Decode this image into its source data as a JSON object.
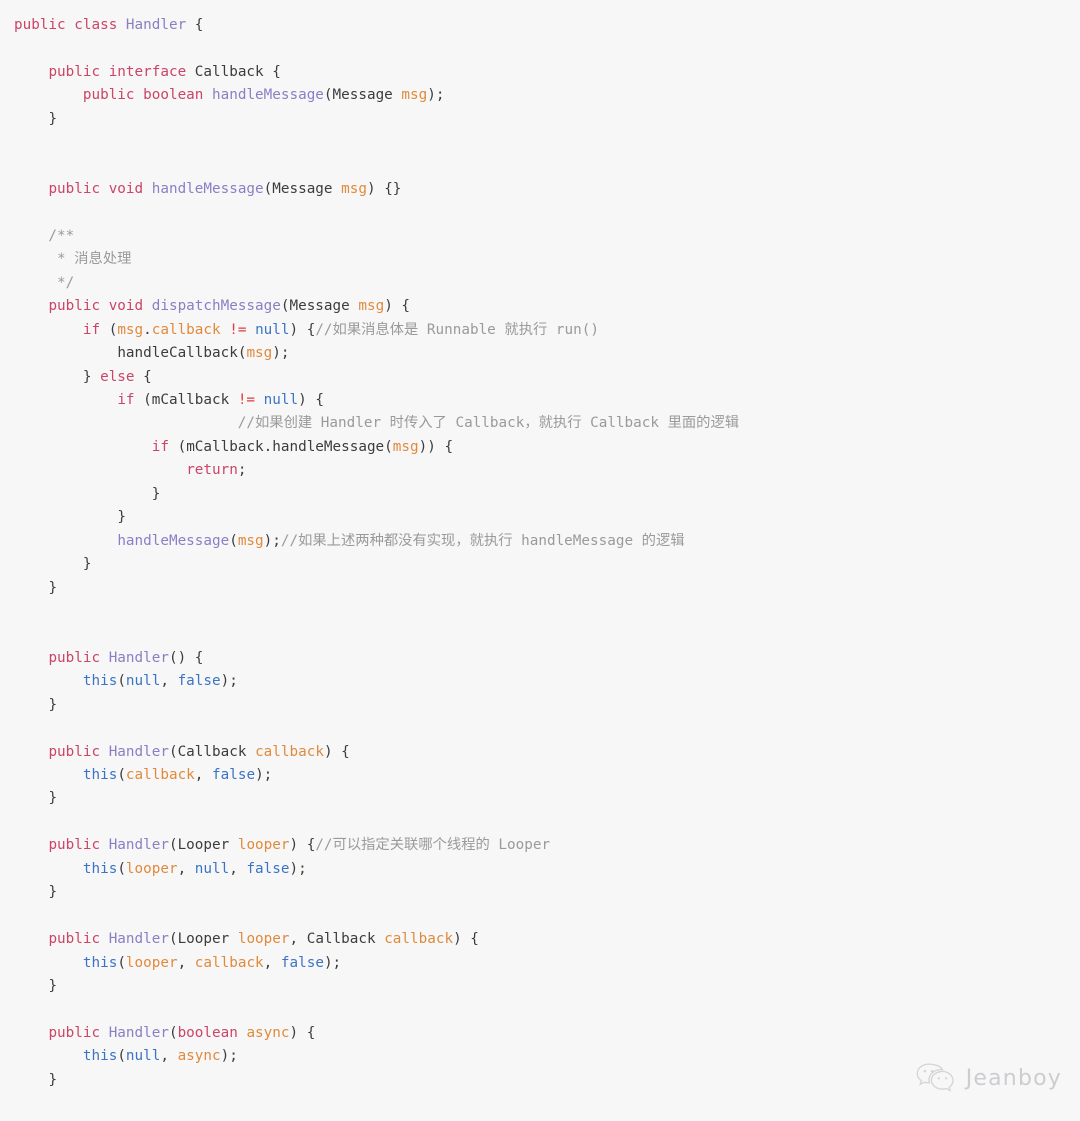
{
  "editor": {
    "language": "java",
    "background_color": "#f7f7f8",
    "default_text_color": "#3c3c3c",
    "colors": {
      "keyword": "#cc4466",
      "type_name": "#8a7fc4",
      "literal": "#3b74c4",
      "parameter": "#e08a3c",
      "operator": "#e03a3a",
      "comment": "#9a9a9a",
      "plain": "#3c3c3c"
    }
  },
  "code": {
    "lines": [
      "public class Handler {",
      "",
      "    public interface Callback {",
      "        public boolean handleMessage(Message msg);",
      "    }",
      "",
      "",
      "    public void handleMessage(Message msg) {}",
      "",
      "    /**",
      "     * 消息处理",
      "     */",
      "    public void dispatchMessage(Message msg) {",
      "        if (msg.callback != null) {//如果消息体是 Runnable 就执行 run()",
      "            handleCallback(msg);",
      "        } else {",
      "            if (mCallback != null) {",
      "                          //如果创建 Handler 时传入了 Callback，就执行 Callback 里面的逻辑",
      "                if (mCallback.handleMessage(msg)) {",
      "                    return;",
      "                }",
      "            }",
      "            handleMessage(msg);//如果上述两种都没有实现，就执行 handleMessage 的逻辑",
      "        }",
      "    }",
      "",
      "",
      "    public Handler() {",
      "        this(null, false);",
      "    }",
      "",
      "    public Handler(Callback callback) {",
      "        this(callback, false);",
      "    }",
      "",
      "    public Handler(Looper looper) {//可以指定关联哪个线程的 Looper",
      "        this(looper, null, false);",
      "    }",
      "",
      "    public Handler(Looper looper, Callback callback) {",
      "        this(looper, callback, false);",
      "    }",
      "",
      "    public Handler(boolean async) {",
      "        this(null, async);",
      "    }"
    ],
    "comments": [
      "/**",
      "* 消息处理",
      "*/",
      "//如果消息体是 Runnable 就执行 run()",
      "//如果创建 Handler 时传入了 Callback，就执行 Callback 里面的逻辑",
      "//如果上述两种都没有实现，就执行 handleMessage 的逻辑",
      "//可以指定关联哪个线程的 Looper"
    ]
  },
  "watermark": {
    "icon": "wechat-icon",
    "label": "Jeanboy"
  }
}
